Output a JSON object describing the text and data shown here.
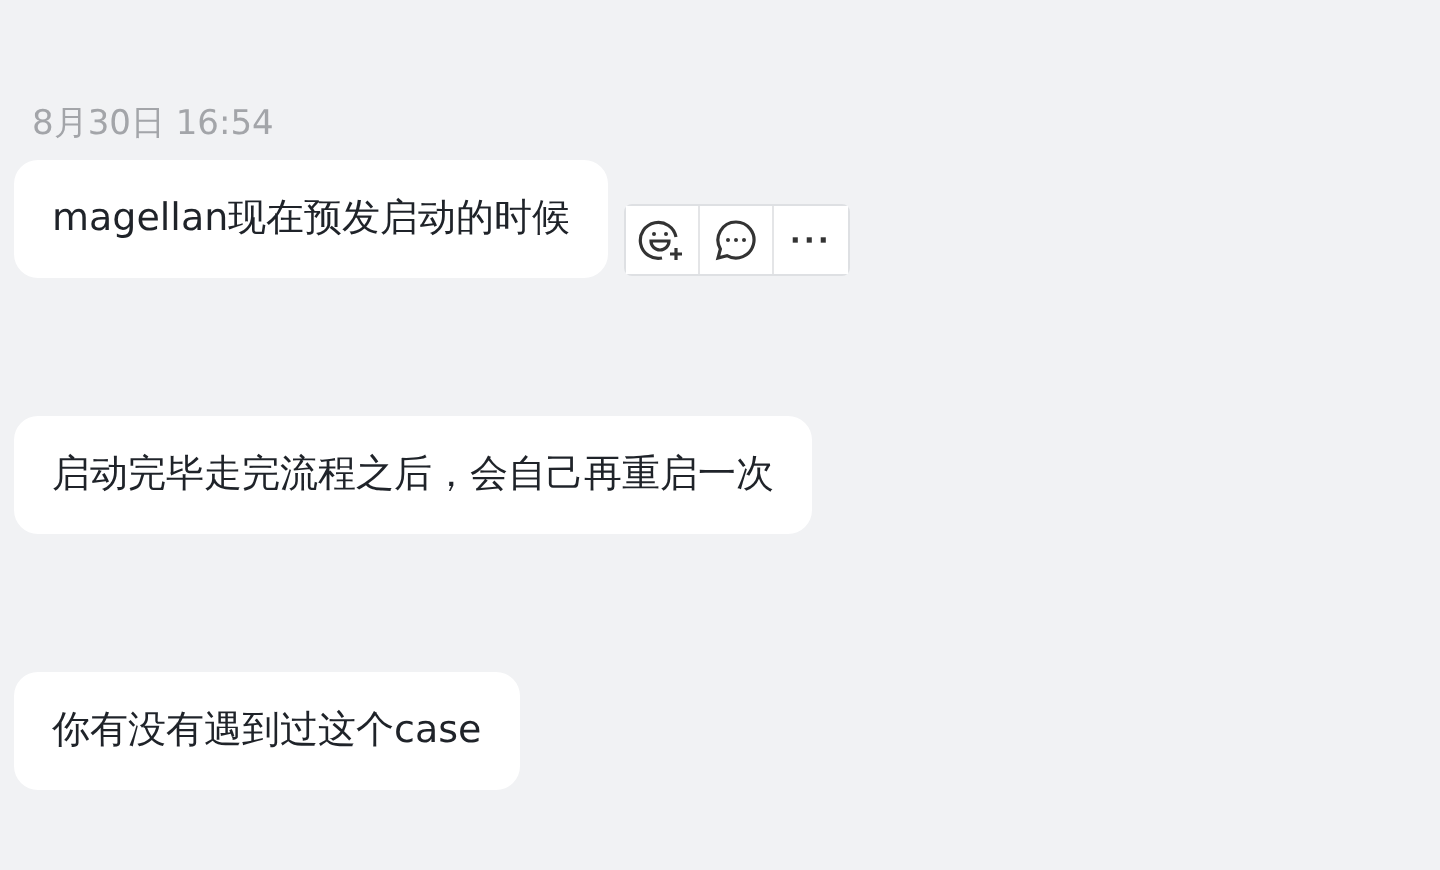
{
  "timestamp": "8月30日 16:54",
  "messages": [
    {
      "text": "magellan现在预发启动的时候",
      "actions_shown": true
    },
    {
      "text": "启动完毕走完流程之后，会自己再重启一次",
      "actions_shown": false
    },
    {
      "text": "你有没有遇到过这个case",
      "actions_shown": false
    }
  ],
  "more_glyph": "···"
}
